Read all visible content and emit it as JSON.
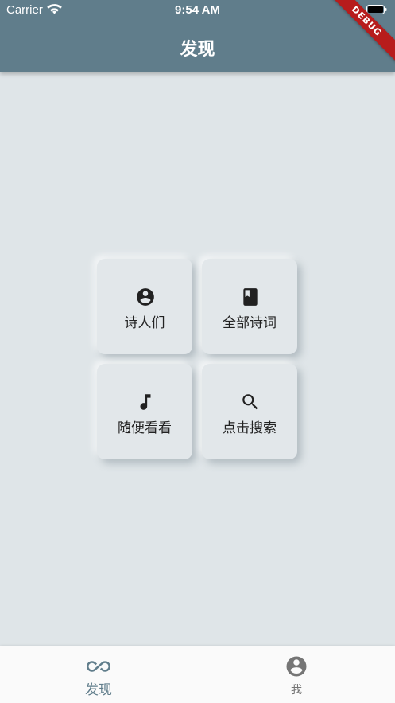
{
  "status_bar": {
    "carrier": "Carrier",
    "time": "9:54 AM"
  },
  "app_bar": {
    "title": "发现",
    "background": "#607d8b"
  },
  "debug_banner": "DEBUG",
  "tiles": [
    {
      "label": "诗人们",
      "icon": "account-circle-icon"
    },
    {
      "label": "全部诗词",
      "icon": "book-icon"
    },
    {
      "label": "随便看看",
      "icon": "music-note-icon"
    },
    {
      "label": "点击搜索",
      "icon": "search-icon"
    }
  ],
  "bottom_nav": {
    "items": [
      {
        "label": "发现",
        "icon": "infinity-icon",
        "selected": true,
        "color": "#607d8b"
      },
      {
        "label": "我",
        "icon": "account-circle-icon",
        "selected": false,
        "color": "#757575"
      }
    ]
  }
}
